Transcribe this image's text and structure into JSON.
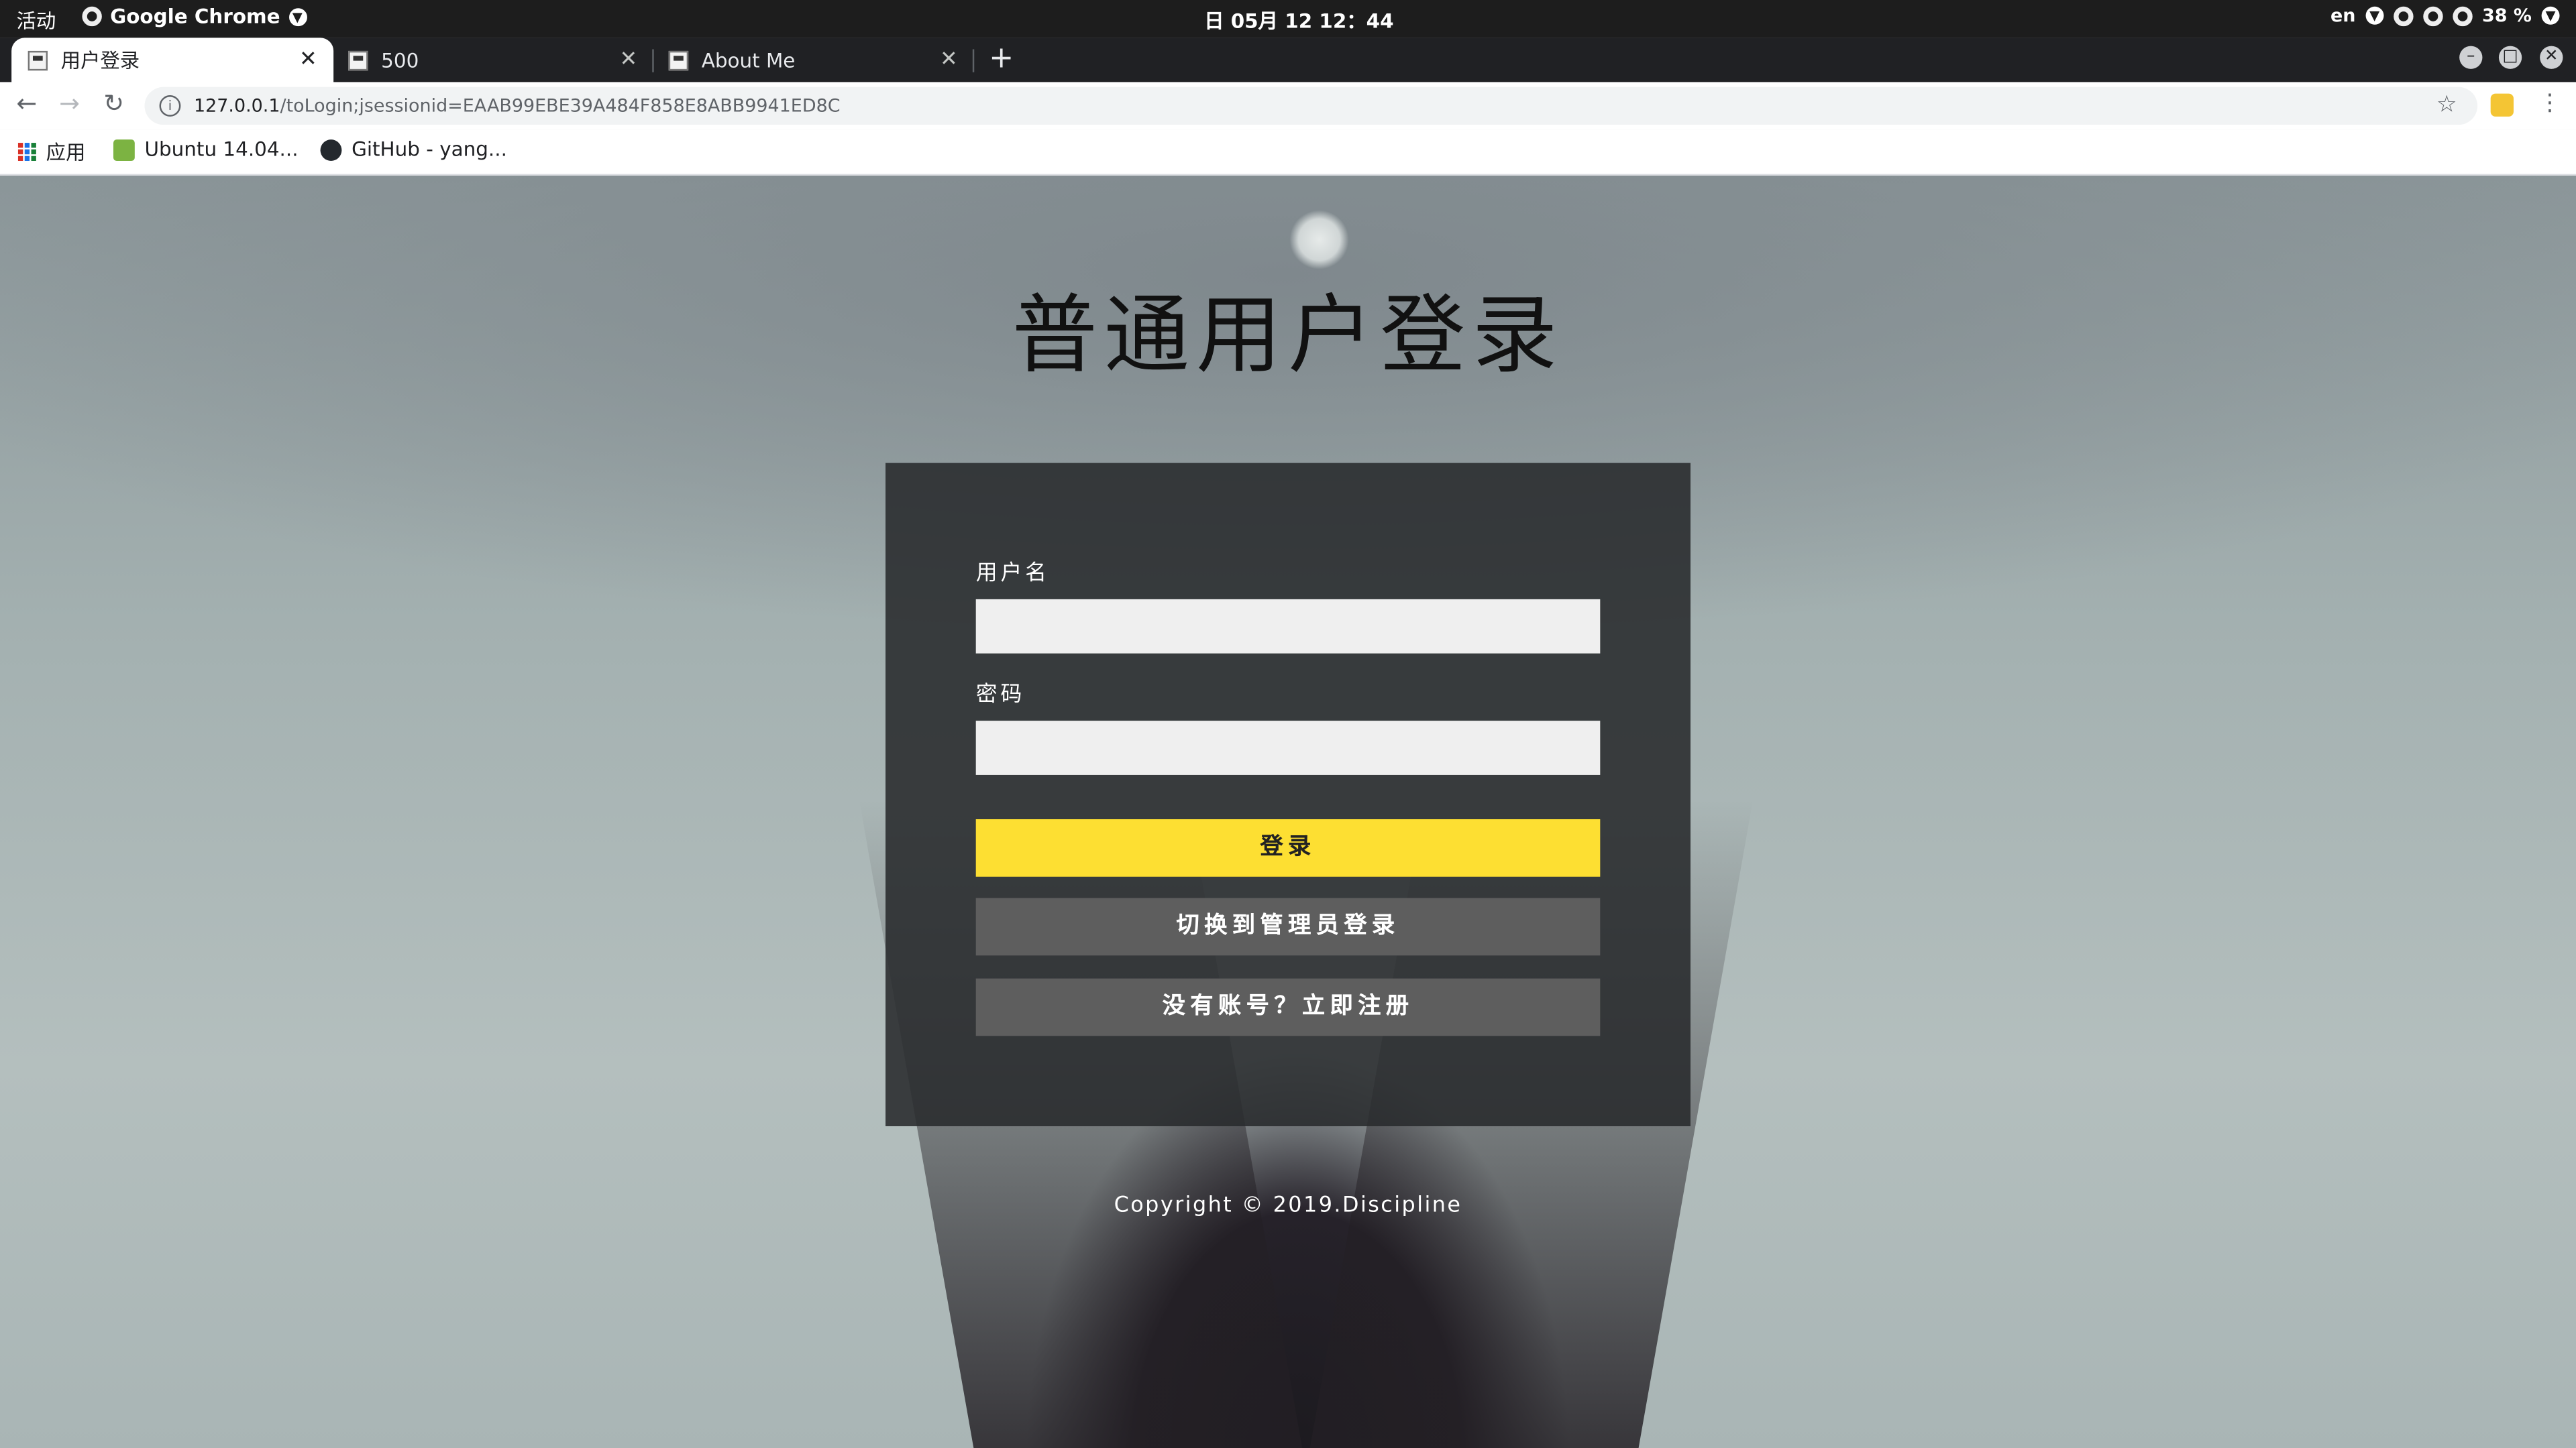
{
  "os": {
    "activities": "活动",
    "app_name": "Google Chrome",
    "clock": "日 05月 12  12：44",
    "keyboard_layout": "en",
    "battery": "38 %"
  },
  "browser": {
    "tabs": [
      {
        "title": "用户登录",
        "active": true
      },
      {
        "title": "500",
        "active": false
      },
      {
        "title": "About Me",
        "active": false
      }
    ],
    "url_host": "127.0.0.1",
    "url_path": "/toLogin;jsessionid=EAAB99EBE39A484F858E8ABB9941ED8C",
    "bookmarks": [
      {
        "label": "应用",
        "icon": "apps-grid-icon"
      },
      {
        "label": "Ubuntu 14.04...",
        "icon": "bookmark-favicon"
      },
      {
        "label": "GitHub - yang...",
        "icon": "github-icon"
      }
    ]
  },
  "login": {
    "heading": "普通用户登录",
    "username_label": "用户名",
    "username_value": "",
    "password_label": "密码",
    "password_value": "",
    "submit_label": "登录",
    "switch_admin_label": "切换到管理员登录",
    "register_label": "没有账号？立即注册",
    "copyright": "Copyright © 2019.Discipline"
  },
  "colors": {
    "accent_yellow": "#fddf32",
    "panel": "#2b2d2f",
    "secondary_button": "#5e5e5e"
  }
}
